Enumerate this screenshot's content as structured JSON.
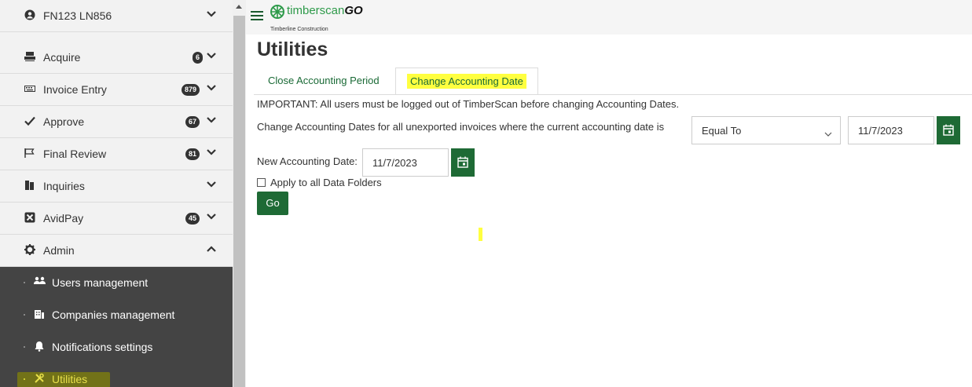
{
  "sidebar": {
    "items": [
      {
        "label": "FN123 LN856",
        "icon": "user-circle-icon",
        "badge": ""
      },
      {
        "label": "Acquire",
        "icon": "scanner-icon",
        "badge": "6"
      },
      {
        "label": "Invoice Entry",
        "icon": "keyboard-icon",
        "badge": "879"
      },
      {
        "label": "Approve",
        "icon": "checkmark-icon",
        "badge": "67"
      },
      {
        "label": "Final Review",
        "icon": "flag-icon",
        "badge": "81"
      },
      {
        "label": "Inquiries",
        "icon": "documents-icon",
        "badge": ""
      },
      {
        "label": "AvidPay",
        "icon": "avidpay-icon",
        "badge": "45"
      },
      {
        "label": "Admin",
        "icon": "gear-icon",
        "badge": ""
      }
    ],
    "submenu": [
      {
        "label": "Users management",
        "icon": "users-icon"
      },
      {
        "label": "Companies management",
        "icon": "building-icon"
      },
      {
        "label": "Notifications settings",
        "icon": "bell-icon"
      },
      {
        "label": "Utilities",
        "icon": "tools-icon"
      }
    ]
  },
  "header": {
    "logo_main": "timberscan",
    "logo_suffix": "GO",
    "company": "Timberline Construction"
  },
  "main": {
    "title": "Utilities",
    "tabs": [
      {
        "label": "Close Accounting Period",
        "active": false
      },
      {
        "label": "Change Accounting Date",
        "active": true
      }
    ],
    "important": "IMPORTANT: All users must be logged out of TimberScan before changing Accounting Dates.",
    "change_label": "Change Accounting Dates for all unexported invoices where the current accounting date is",
    "condition_value": "Equal To",
    "current_date": "11/7/2023",
    "new_date_label": "New Accounting Date:",
    "new_date": "11/7/2023",
    "apply_label": "Apply to all Data Folders",
    "apply_checked": false,
    "go_label": "Go"
  },
  "colors": {
    "brand_green": "#1e6a35",
    "highlight_yellow": "#ffff40",
    "sidebar_bg": "#f2f2f2",
    "submenu_bg": "#444444"
  }
}
